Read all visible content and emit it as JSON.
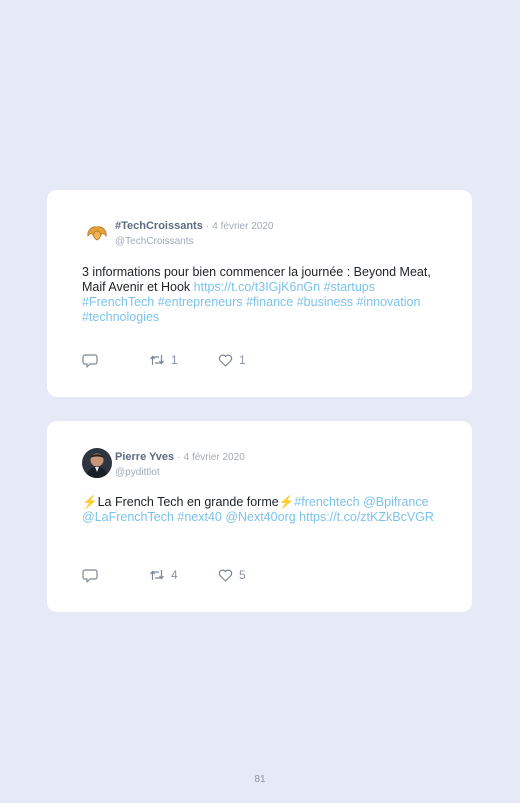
{
  "tweets": [
    {
      "name": "#TechCroissants",
      "separator": "·",
      "date": "4 février 2020",
      "handle": "@TechCroissants",
      "text_plain": "3 informations pour bien commencer la journée : Beyond Meat, Maif Avenir et Hook ",
      "text_link": "https://t.co/t3IGjK6nGn #startups #FrenchTech #entrepreneurs #finance #business #innovation #technologies",
      "retweets": "1",
      "likes": "1",
      "avatar_icon": "croissant-icon"
    },
    {
      "name": "Pierre Yves",
      "separator": "·",
      "date": "4 février 2020",
      "handle": "@pydittlot",
      "emoji": "⚡",
      "text_plain": "La French Tech en grande forme",
      "text_link": "#frenchtech @Bpifrance @LaFrenchTech #next40 @Next40org https://t.co/ztKZkBcVGR",
      "retweets": "4",
      "likes": "5",
      "avatar_icon": "profile-photo"
    }
  ],
  "page": {
    "number": "81"
  },
  "colors": {
    "background": "#e6eaf6",
    "card": "#ffffff",
    "link": "#7cc3ec",
    "text": "#1d2129",
    "muted": "#a2abb8"
  },
  "icons": {
    "reply": "reply-icon",
    "retweet": "retweet-icon",
    "like": "heart-icon",
    "lightning": "lightning-emoji"
  }
}
